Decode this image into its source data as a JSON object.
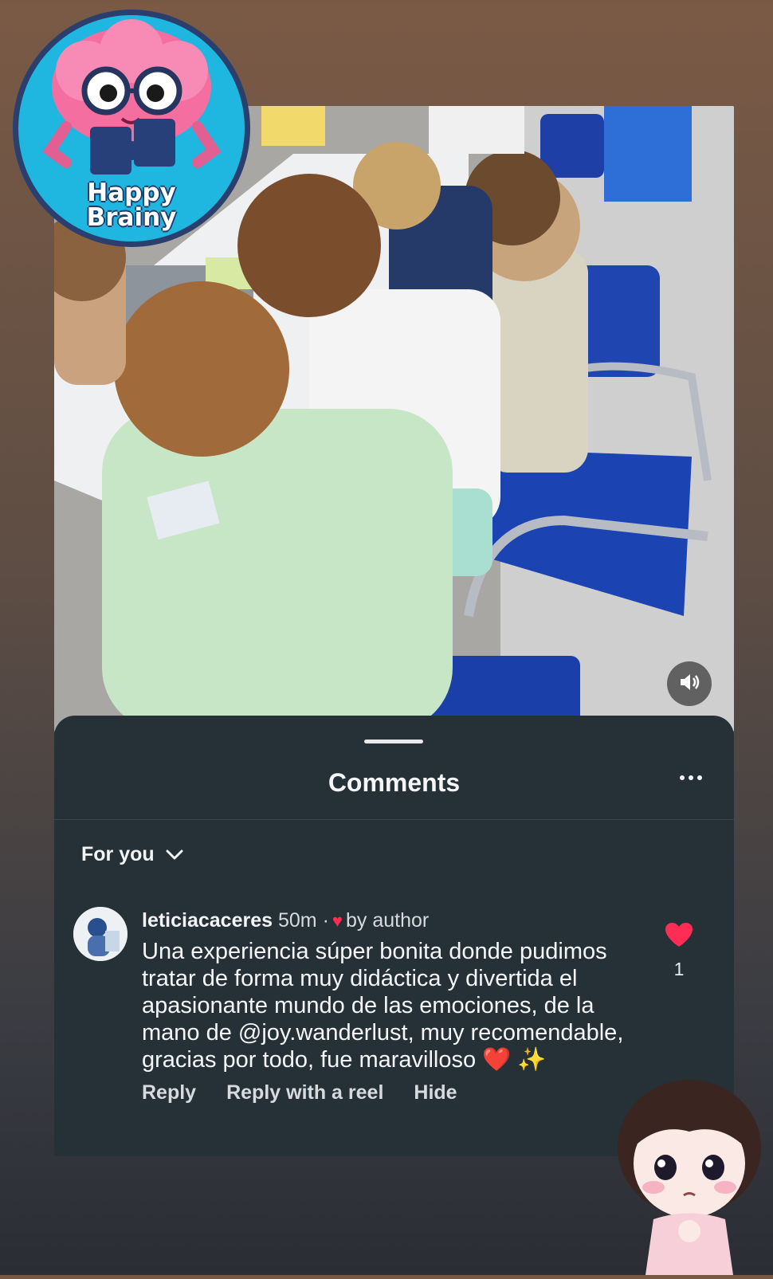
{
  "story": {
    "sticker_logo": {
      "text_line1": "Happy",
      "text_line2": "Brainy",
      "icon": "brain-with-glasses-icon"
    },
    "volume_icon": "speaker-icon",
    "sticker_girl_icon": "chibi-girl-sticker-icon"
  },
  "comments_sheet": {
    "title": "Comments",
    "more_icon": "more-options-icon",
    "filter": {
      "label": "For you",
      "icon": "chevron-down-icon"
    },
    "comments": [
      {
        "username": "leticiacaceres",
        "time": "50m",
        "separator": "·",
        "liked_by_author_label": "by author",
        "text": "Una experiencia súper bonita donde pudimos tratar de forma muy didáctica y divertida el apasionante mundo de las emociones, de la mano de @joy.wanderlust, muy recomendable, gracias por todo, fue maravilloso ❤️ ✨",
        "like_count": "1",
        "actions": {
          "reply": "Reply",
          "reply_reel": "Reply with a reel",
          "hide": "Hide"
        }
      }
    ]
  },
  "colors": {
    "sheet_bg": "#263037",
    "heart": "#ff2d55",
    "logo_bg": "#1fb6e0"
  }
}
